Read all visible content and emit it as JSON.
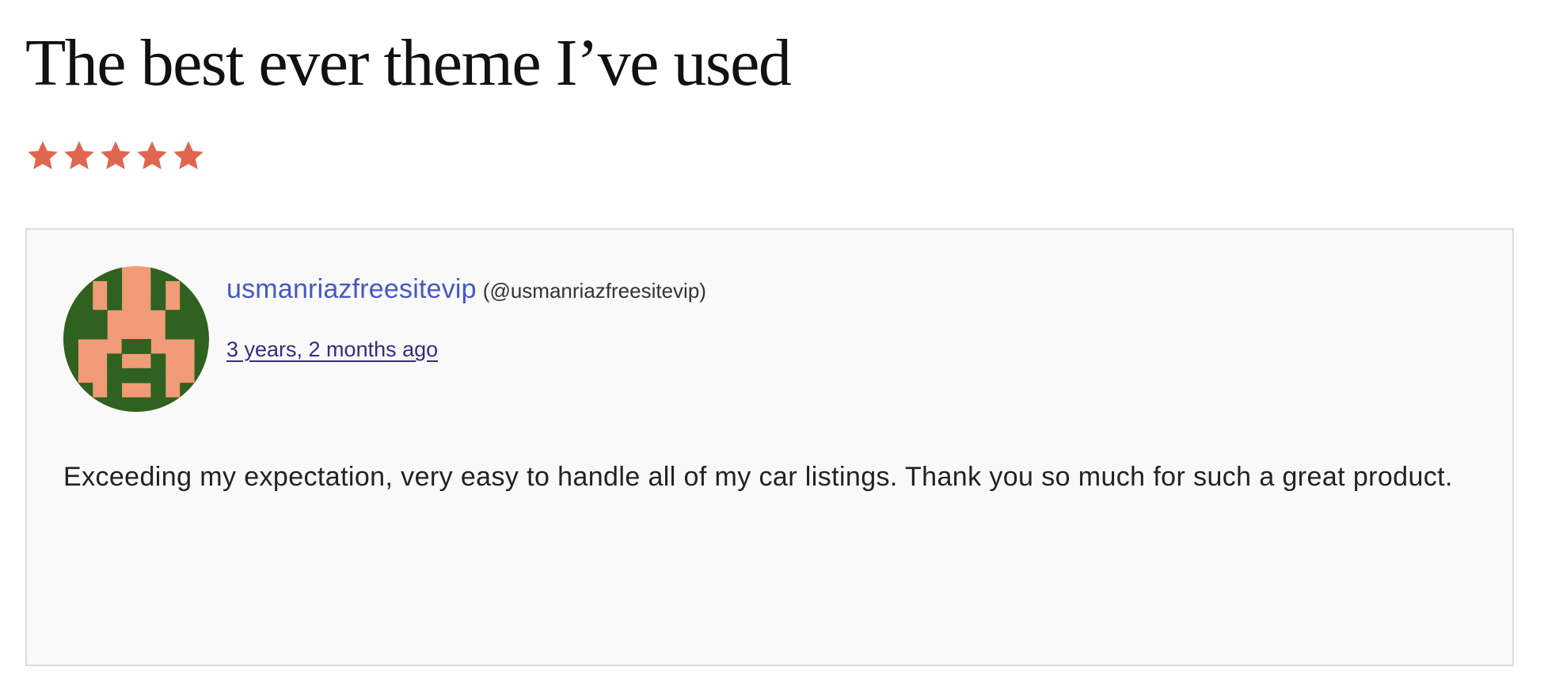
{
  "review": {
    "title": "The best ever theme I’ve used",
    "rating": 5,
    "rating_max": 5,
    "star_color": "#e0674f",
    "star_icon": "star-icon",
    "author": {
      "display_name": "usmanriazfreesitevip",
      "handle": "(@usmanriazfreesitevip)",
      "avatar_icon": "identicon-avatar",
      "avatar_colors": {
        "background": "#f29b77",
        "foreground": "#2f6220"
      }
    },
    "date_text": "3 years, 2 months ago",
    "body": "Exceeding my expectation, very easy to handle all of my car listings. Thank you so much for such a great product."
  },
  "colors": {
    "card_background": "#f9f9f9",
    "card_border": "#dcdcdc",
    "author_link": "#4758c4",
    "date_link": "#3d2a7a"
  }
}
